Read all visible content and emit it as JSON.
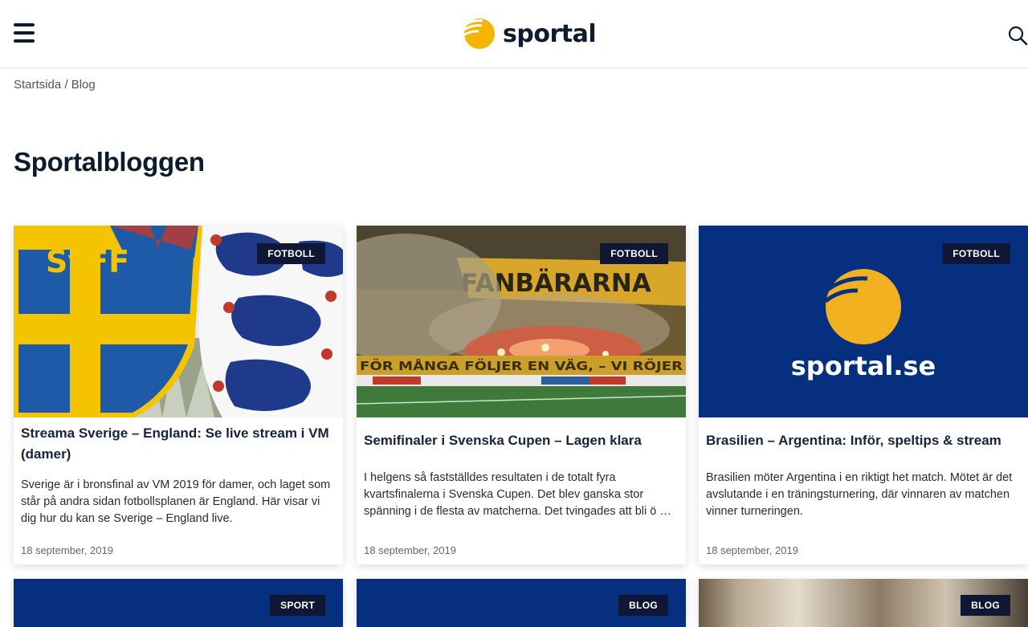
{
  "header": {
    "menu_icon": "hamburger-menu-icon",
    "logo_text": "sportal",
    "search_icon": "search-icon",
    "brand_color": "#f5b400",
    "navy": "#0f1734"
  },
  "breadcrumb": {
    "home": "Startsida",
    "separator": "/",
    "current": "Blog"
  },
  "page_title": "Sportalbloggen",
  "cards": [
    {
      "category": "FOTBOLL",
      "title": "Streama Sverige – England: Se live stream i VM (damer)",
      "excerpt": "Sverige är i bronsfinal av VM 2019 för damer, och laget som står på andra sidan fotbollsplanen är England. Här visar vi dig hur du kan se Sverige – England live.",
      "date": "18 september, 2019",
      "image_text": "SvFF"
    },
    {
      "category": "FOTBOLL",
      "title": "Semifinaler i Svenska Cupen – Lagen klara",
      "excerpt": "I helgens så fastställdes resultaten i de totalt fyra kvartsfinalerna i Svenska Cupen. Det blev ganska stor spänning i de flesta av matcherna. Det tvingades att bli ö …",
      "date": "18 september, 2019",
      "image_text": "FANBÄRARNA",
      "image_text_2": "FÖR MÅNGA FÖLJER EN VÄG, – VI RÖJER"
    },
    {
      "category": "FOTBOLL",
      "title": "Brasilien – Argentina: Inför, speltips & stream",
      "excerpt": "Brasilien möter Argentina i en riktigt het match. Mötet är det avslutande i en träningsturnering, där vinnaren av matchen vinner turneringen.",
      "date": "18 september, 2019",
      "image_text": "sportal.se"
    },
    {
      "category": "SPORT"
    },
    {
      "category": "BLOG"
    },
    {
      "category": "BLOG"
    }
  ]
}
